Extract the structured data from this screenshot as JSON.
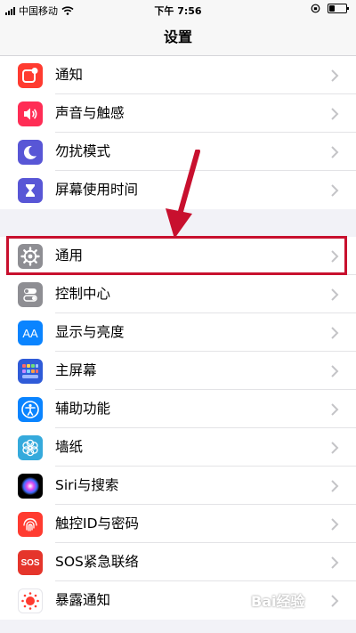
{
  "status_bar": {
    "carrier": "中国移动",
    "time": "下午 7:56"
  },
  "nav": {
    "title": "设置"
  },
  "groups": [
    {
      "items": [
        {
          "label": "通知",
          "icon": "notifications-icon",
          "color": "#ff3b30"
        },
        {
          "label": "声音与触感",
          "icon": "speaker-icon",
          "color": "#ff2d55"
        },
        {
          "label": "勿扰模式",
          "icon": "moon-icon",
          "color": "#5856d6"
        },
        {
          "label": "屏幕使用时间",
          "icon": "hourglass-icon",
          "color": "#5856d6"
        }
      ]
    },
    {
      "items": [
        {
          "label": "通用",
          "icon": "gear-icon",
          "color": "#8e8e93"
        },
        {
          "label": "控制中心",
          "icon": "toggle-icon",
          "color": "#8e8e93"
        },
        {
          "label": "显示与亮度",
          "icon": "text-size-icon",
          "color": "#0a84ff"
        },
        {
          "label": "主屏幕",
          "icon": "home-screen-icon",
          "color": "#2f5bd8"
        },
        {
          "label": "辅助功能",
          "icon": "accessibility-icon",
          "color": "#0a84ff"
        },
        {
          "label": "墙纸",
          "icon": "flower-icon",
          "color": "#35aadc"
        },
        {
          "label": "Siri与搜索",
          "icon": "siri-icon",
          "color": "#000000"
        },
        {
          "label": "触控ID与密码",
          "icon": "fingerprint-icon",
          "color": "#ff3b30"
        },
        {
          "label": "SOS紧急联络",
          "icon": "sos-icon",
          "color": "#e5352b"
        },
        {
          "label": "暴露通知",
          "icon": "exposure-icon",
          "color": "#ffffff"
        }
      ]
    }
  ],
  "icon_text": {
    "text_size": "AA",
    "sos": "SOS"
  },
  "annotation": {
    "highlight_color": "#c8102e"
  },
  "watermark": {
    "text": "Bai经验"
  }
}
